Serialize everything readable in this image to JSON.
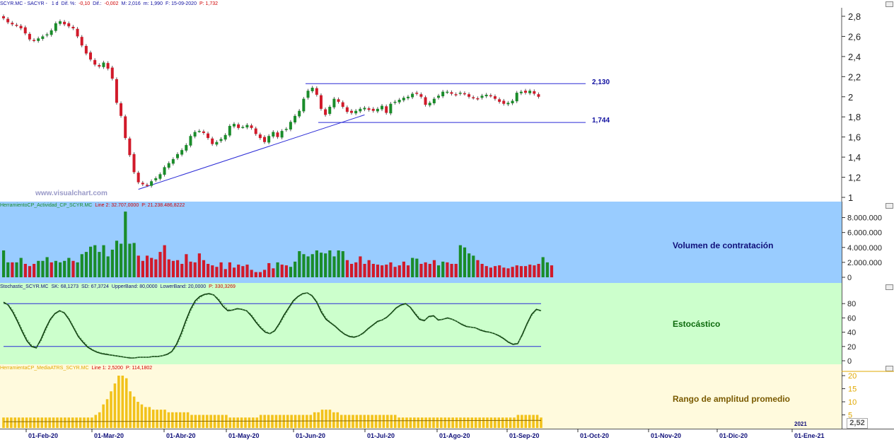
{
  "headers": {
    "price": {
      "symbol": "SCYR.MC - SACYR - ",
      "tf": "1 d",
      "dif_pct_label": "Dif. %:",
      "dif_pct": "-0,10",
      "dif_label": "Dif.:",
      "dif": "-0,002",
      "max": "M: 2,016",
      "min": "m: 1,990",
      "fecha": "F: 15-09-2020",
      "precio": "P: 1,732"
    },
    "volume": {
      "name": "HerramientoCP_Actividad_CP_SCYR.MC",
      "line2": "Line 2: 32.707,0000",
      "p": "P: 21.238.486,8222"
    },
    "stoch": {
      "name": "Stochastic_SCYR.MC",
      "sk": "SK: 68,1273",
      "sd": "SD: 67,3724",
      "upper": "UpperBand: 80,0000",
      "lower": "LowerBand: 20,0000",
      "p": "P: 330,3269"
    },
    "atr": {
      "name": "HerramientaCP_MediaATRS_SCYR.MC",
      "line1": "Line 1: 2,5200",
      "p": "P: 114,1802"
    }
  },
  "watermark": "www.visualchart.com",
  "panel_titles": {
    "volume": "Volumen de contratación",
    "stoch": "Estocástico",
    "atr": "Rango de amplitud promedio"
  },
  "levels": {
    "resistance": "2,130",
    "support": "1,744"
  },
  "atr_current": "2,52",
  "x_axis": [
    "01-Feb-20",
    "01-Mar-20",
    "01-Abr-20",
    "01-May-20",
    "01-Jun-20",
    "01-Jul-20",
    "01-Ago-20",
    "01-Sep-20",
    "01-Oct-20",
    "01-Nov-20",
    "01-Dic-20",
    "01-Ene-21"
  ],
  "year_marker": "2021",
  "colors": {
    "up": "#1a8c2a",
    "down": "#d11a2a",
    "vol_bg": "#99ccff",
    "stoch_bg": "#ccffcc",
    "atr_bg": "#fffadd",
    "line": "#2b2bd6",
    "atr_bar": "#f2c21b"
  },
  "chart_data": [
    {
      "type": "candlestick",
      "title": "SCYR.MC - SACYR",
      "y_ticks": [
        "2,8",
        "2,6",
        "2,4",
        "2,2",
        "2",
        "1,8",
        "1,6",
        "1,4",
        "1,2",
        "1"
      ],
      "ylim": [
        1,
        2.85
      ],
      "close": [
        2.78,
        2.74,
        2.72,
        2.71,
        2.68,
        2.63,
        2.57,
        2.56,
        2.58,
        2.6,
        2.62,
        2.66,
        2.73,
        2.75,
        2.72,
        2.7,
        2.68,
        2.6,
        2.51,
        2.43,
        2.37,
        2.32,
        2.3,
        2.34,
        2.28,
        2.18,
        1.94,
        1.81,
        1.59,
        1.42,
        1.25,
        1.15,
        1.13,
        1.12,
        1.16,
        1.19,
        1.23,
        1.3,
        1.34,
        1.38,
        1.43,
        1.47,
        1.52,
        1.61,
        1.65,
        1.66,
        1.64,
        1.59,
        1.53,
        1.55,
        1.58,
        1.62,
        1.71,
        1.73,
        1.69,
        1.7,
        1.72,
        1.69,
        1.63,
        1.59,
        1.55,
        1.61,
        1.65,
        1.6,
        1.66,
        1.68,
        1.75,
        1.81,
        1.86,
        1.98,
        2.06,
        2.09,
        2.02,
        1.88,
        1.82,
        1.9,
        1.98,
        1.95,
        1.9,
        1.85,
        1.84,
        1.86,
        1.88,
        1.89,
        1.87,
        1.86,
        1.88,
        1.91,
        1.84,
        1.93,
        1.95,
        1.97,
        1.99,
        2.0,
        2.03,
        2.03,
        2.0,
        1.92,
        1.94,
        1.98,
        2.01,
        2.05,
        2.05,
        2.03,
        2.02,
        2.04,
        2.03,
        2.0,
        1.99,
        1.98,
        2.01,
        2.02,
        2.01,
        1.98,
        1.95,
        1.93,
        1.94,
        1.96,
        2.04,
        2.05,
        2.04,
        2.06,
        2.03,
        2.0
      ],
      "levels": [
        2.13,
        1.744
      ],
      "trendline": {
        "from_index": 31,
        "from_value": 1.08,
        "to_index": 83,
        "to_value": 1.82
      }
    },
    {
      "type": "bar",
      "title": "Volumen de contratación",
      "y_ticks": [
        "8.000.000",
        "6.000.000",
        "4.000.000",
        "2.000.000",
        "0"
      ],
      "ylim": [
        0,
        9000000
      ],
      "values": [
        3600000,
        2000000,
        2000000,
        2000000,
        2600000,
        1800000,
        1500000,
        1800000,
        2200000,
        2200000,
        2700000,
        2000000,
        2200000,
        2000000,
        2200000,
        2600000,
        2200000,
        2000000,
        3100000,
        3400000,
        4100000,
        4300000,
        3400000,
        4300000,
        2800000,
        3700000,
        4900000,
        4500000,
        8800000,
        4500000,
        4600000,
        2900000,
        2200000,
        2900000,
        2600000,
        2400000,
        3400000,
        4300000,
        2400000,
        2200000,
        2300000,
        1800000,
        3100000,
        2100000,
        2000000,
        3200000,
        2300000,
        1800000,
        1600000,
        1400000,
        2000000,
        1100000,
        2000000,
        1300000,
        1700000,
        1500000,
        1700000,
        1000000,
        700000,
        700000,
        1000000,
        1900000,
        1200000,
        2000000,
        1700000,
        1600000,
        1400000,
        2100000,
        3500000,
        3100000,
        2800000,
        3100000,
        3600000,
        3300000,
        3200000,
        3600000,
        2800000,
        3600000,
        3500000,
        2300000,
        1800000,
        2000000,
        2800000,
        1800000,
        2300000,
        1800000,
        1700000,
        1600000,
        1700000,
        2000000,
        1400000,
        1600000,
        2100000,
        1600000,
        2600000,
        2500000,
        1800000,
        2000000,
        1800000,
        2300000,
        1600000,
        2100000,
        2000000,
        1800000,
        1800000,
        4300000,
        4000000,
        3200000,
        2900000,
        2300000,
        1800000,
        1500000,
        1300000,
        1500000,
        1600000,
        1300000,
        1200000,
        1400000,
        1600000,
        1500000,
        1500000,
        1700000,
        1600000,
        1800000,
        2700000,
        2000000,
        1600000
      ],
      "up": [
        1,
        1,
        0,
        1,
        1,
        0,
        0,
        0,
        1,
        1,
        1,
        0,
        1,
        1,
        1,
        1,
        0,
        1,
        1,
        1,
        1,
        1,
        1,
        1,
        1,
        1,
        1,
        1,
        1,
        1,
        1,
        0,
        0,
        0,
        0,
        0,
        0,
        0,
        0,
        0,
        0,
        0,
        0,
        0,
        0,
        0,
        0,
        0,
        0,
        0,
        0,
        0,
        0,
        0,
        0,
        0,
        0,
        0,
        0,
        0,
        0,
        0,
        0,
        1,
        0,
        0,
        1,
        1,
        1,
        1,
        1,
        1,
        1,
        1,
        1,
        1,
        1,
        1,
        1,
        0,
        0,
        0,
        0,
        0,
        0,
        0,
        0,
        0,
        0,
        0,
        0,
        0,
        0,
        0,
        1,
        1,
        0,
        0,
        0,
        0,
        1,
        1,
        0,
        0,
        0,
        1,
        1,
        1,
        1,
        0,
        0,
        0,
        0,
        0,
        0,
        0,
        0,
        0,
        0,
        0,
        0,
        0,
        0,
        0,
        1,
        1,
        0
      ]
    },
    {
      "type": "line",
      "title": "Estocástico",
      "y_ticks": [
        "80",
        "60",
        "40",
        "20",
        "0"
      ],
      "ylim": [
        0,
        100
      ],
      "bands": [
        80,
        20
      ],
      "series": [
        {
          "name": "SK",
          "values": [
            82,
            78,
            68,
            55,
            41,
            28,
            20,
            18,
            30,
            45,
            58,
            66,
            70,
            67,
            58,
            46,
            34,
            26,
            19,
            15,
            12,
            10,
            9,
            8,
            7,
            6,
            5,
            4,
            4,
            5,
            5,
            5,
            6,
            6,
            7,
            9,
            13,
            23,
            38,
            56,
            72,
            84,
            90,
            93,
            94,
            92,
            85,
            76,
            70,
            71,
            73,
            72,
            70,
            63,
            54,
            46,
            40,
            38,
            42,
            52,
            64,
            74,
            84,
            90,
            94,
            95,
            91,
            82,
            68,
            58,
            53,
            48,
            42,
            37,
            34,
            33,
            35,
            39,
            45,
            50,
            55,
            57,
            61,
            67,
            74,
            78,
            80,
            75,
            66,
            58,
            56,
            62,
            63,
            57,
            58,
            60,
            58,
            55,
            51,
            48,
            47,
            46,
            43,
            41,
            40,
            38,
            35,
            31,
            26,
            23,
            24,
            37,
            52,
            65,
            72,
            70
          ]
        },
        {
          "name": "SD",
          "values": [
            80,
            79,
            71,
            58,
            44,
            31,
            22,
            19,
            27,
            42,
            56,
            65,
            69,
            68,
            60,
            48,
            36,
            28,
            21,
            16,
            13,
            11,
            10,
            8,
            7,
            6,
            5,
            5,
            4,
            5,
            5,
            5,
            6,
            6,
            7,
            8,
            12,
            20,
            34,
            52,
            69,
            81,
            88,
            92,
            93,
            92,
            87,
            79,
            72,
            71,
            72,
            72,
            70,
            65,
            56,
            48,
            42,
            38,
            41,
            50,
            61,
            72,
            82,
            89,
            93,
            95,
            92,
            84,
            71,
            60,
            54,
            49,
            43,
            38,
            35,
            34,
            35,
            38,
            44,
            49,
            54,
            57,
            60,
            66,
            73,
            77,
            79,
            76,
            68,
            60,
            57,
            61,
            62,
            58,
            58,
            59,
            58,
            55,
            52,
            49,
            47,
            46,
            44,
            42,
            40,
            38,
            36,
            32,
            27,
            24,
            25,
            35,
            50,
            63,
            71,
            70
          ]
        }
      ]
    },
    {
      "type": "bar",
      "title": "Rango de amplitud promedio",
      "y_ticks": [
        "20",
        "15",
        "10",
        "5"
      ],
      "ylim": [
        0,
        22
      ],
      "values": [
        4,
        4,
        4,
        4,
        4,
        4,
        4,
        4,
        4,
        4,
        4,
        4,
        4,
        4,
        4,
        4,
        4,
        4,
        4,
        4,
        4,
        4,
        4,
        4,
        5,
        6,
        9,
        11,
        14,
        17,
        20,
        20,
        19,
        14,
        12,
        10,
        9,
        8,
        8,
        7,
        7,
        7,
        7,
        6,
        6,
        6,
        6,
        6,
        6,
        5,
        5,
        5,
        5,
        5,
        5,
        5,
        5,
        5,
        5,
        4,
        4,
        4,
        4,
        4,
        4,
        4,
        4,
        5,
        5,
        5,
        5,
        5,
        5,
        5,
        5,
        5,
        5,
        5,
        5,
        5,
        5,
        6,
        6,
        7,
        7,
        7,
        6,
        6,
        5,
        5,
        5,
        5,
        5,
        5,
        5,
        5,
        5,
        5,
        5,
        5,
        5,
        5,
        5,
        4,
        4,
        4,
        4,
        4,
        4,
        4,
        4,
        4,
        4,
        4,
        4,
        4,
        4,
        4,
        4,
        4,
        4,
        4,
        4,
        4,
        4,
        4,
        4,
        4,
        4,
        4,
        4,
        4,
        4,
        4,
        5,
        5,
        5,
        5,
        5,
        5,
        4
      ],
      "series": [
        {
          "name": "Line 1",
          "values": [
            2.52
          ]
        }
      ]
    }
  ]
}
